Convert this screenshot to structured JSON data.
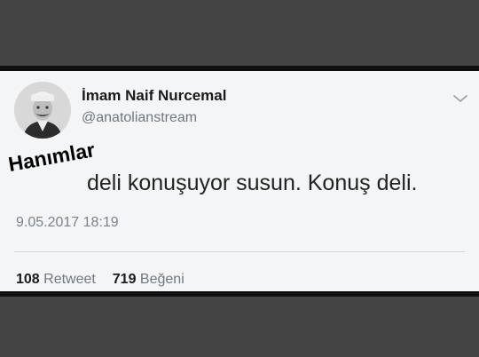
{
  "tweet": {
    "display_name": "İmam Naif Nurcemal",
    "handle": "@anatolianstream",
    "text": "deli konuşuyor susun. Konuş deli.",
    "timestamp": "9.05.2017 18:19",
    "retweet_count": "108",
    "retweet_label": "Retweet",
    "like_count": "719",
    "like_label": "Beğeni"
  },
  "overlay": {
    "text": "Hanımlar"
  },
  "icons": {
    "avatar": "profile-photo",
    "menu": "chevron-down-icon"
  },
  "colors": {
    "card_background": "#f4f5f6",
    "frame": "#444444",
    "secondary_text": "#6f7780"
  }
}
